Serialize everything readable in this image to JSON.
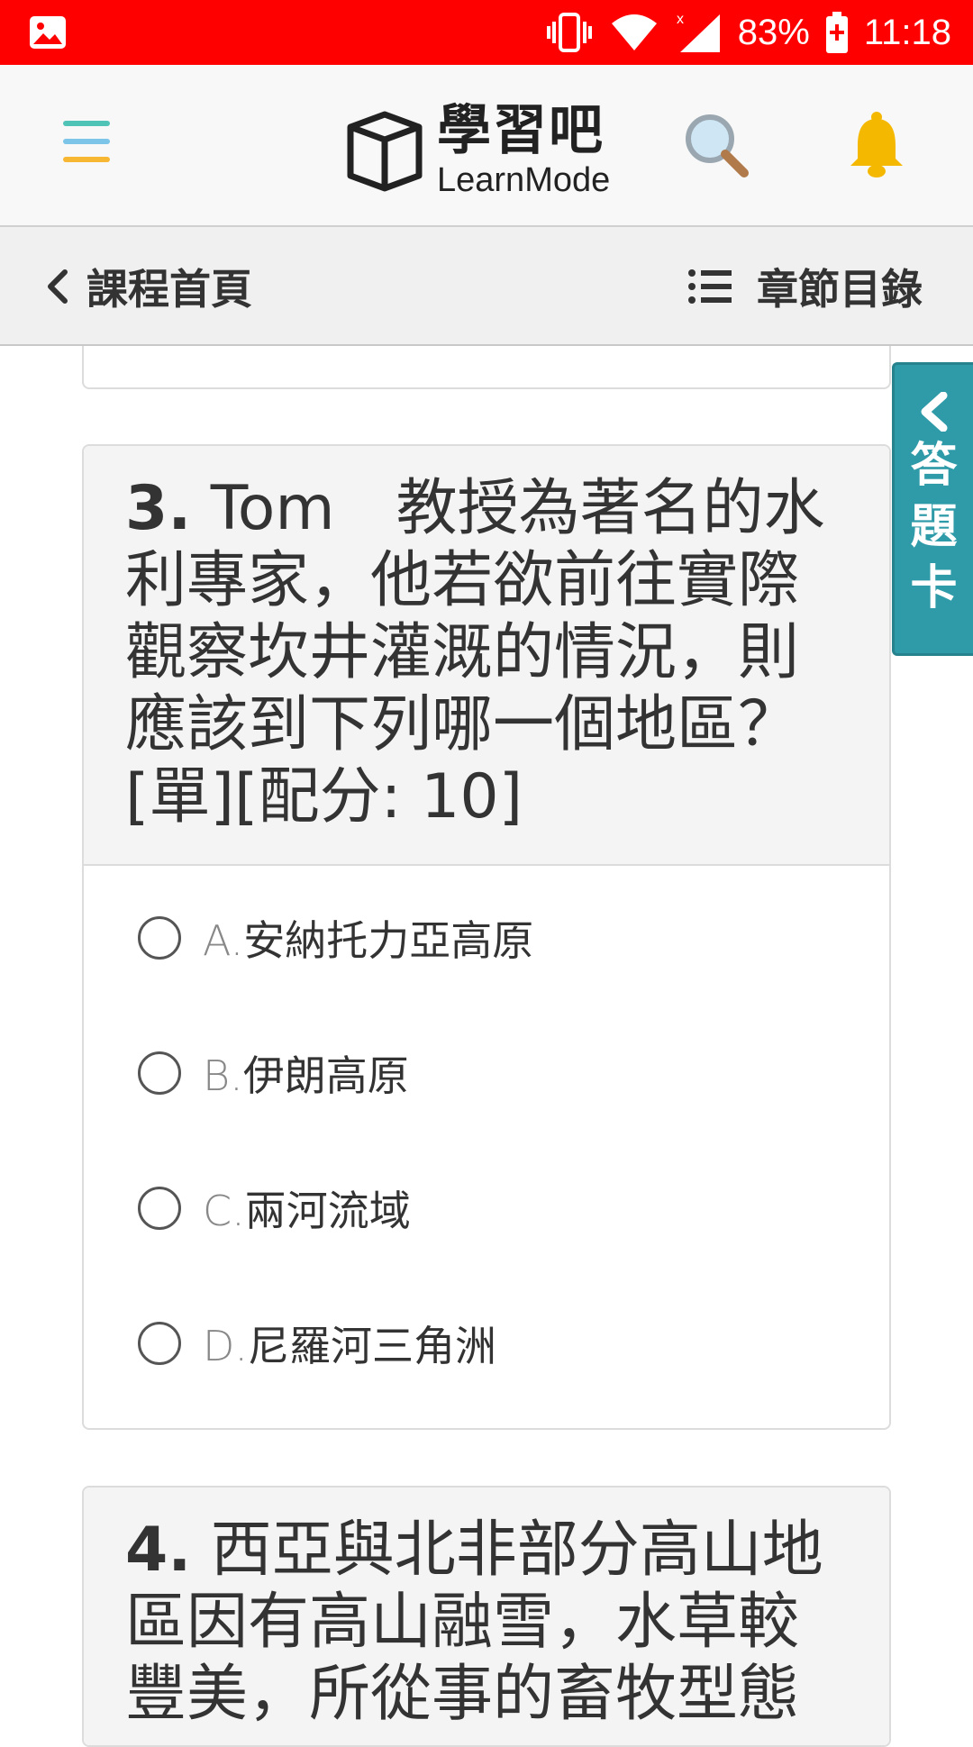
{
  "status_bar": {
    "battery": "83%",
    "time": "11:18",
    "bg_color": "#ff0000",
    "icons": [
      "gallery-icon",
      "vibrate-icon",
      "wifi-icon",
      "signal-icon",
      "battery-charging-icon"
    ]
  },
  "header": {
    "logo_cn": "學習吧",
    "logo_en": "LearnMode",
    "icons": [
      "menu-icon",
      "book-logo-icon",
      "search-icon",
      "bell-icon"
    ]
  },
  "sub_nav": {
    "back_label": "課程首頁",
    "toc_label": "章節目錄"
  },
  "answer_card_tab": {
    "label": "答題卡",
    "color": "#2f9ba8"
  },
  "questions": [
    {
      "number": "3.",
      "text": "Tom　教授為著名的水利專家，他若欲前往實際觀察坎井灌溉的情況，則應該到下列哪一個地區？",
      "meta": "[單][配分: 10]",
      "options": [
        {
          "letter": "A.",
          "text": "安納托力亞高原",
          "selected": false
        },
        {
          "letter": "B.",
          "text": "伊朗高原",
          "selected": false
        },
        {
          "letter": "C.",
          "text": "兩河流域",
          "selected": false
        },
        {
          "letter": "D.",
          "text": "尼羅河三角洲",
          "selected": false
        }
      ]
    },
    {
      "number": "4.",
      "text": "西亞與北非部分高山地區因有高山融雪，水草較豐美，所從事的畜牧型態"
    }
  ]
}
